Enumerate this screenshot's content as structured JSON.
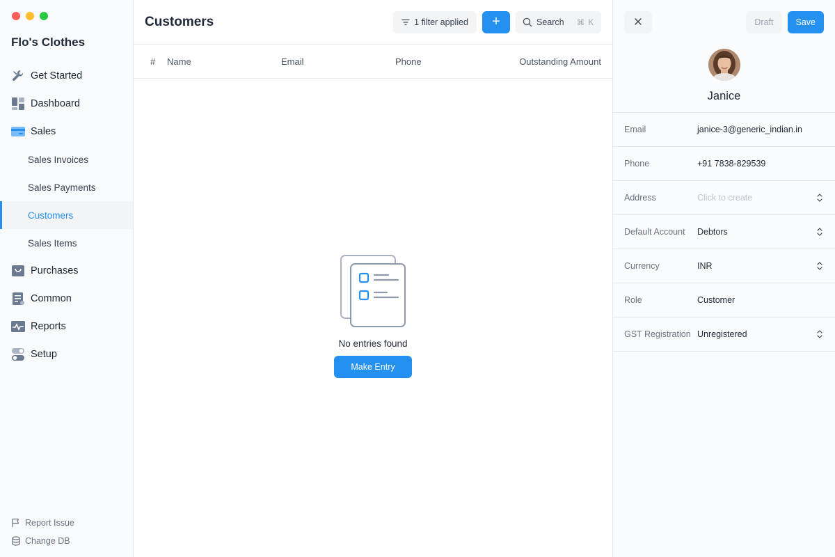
{
  "sidebar": {
    "company": "Flo's Clothes",
    "items": [
      {
        "label": "Get Started",
        "icon": "wrench-icon"
      },
      {
        "label": "Dashboard",
        "icon": "dashboard-icon"
      },
      {
        "label": "Sales",
        "icon": "card-icon"
      },
      {
        "label": "Purchases",
        "icon": "bag-icon"
      },
      {
        "label": "Common",
        "icon": "document-icon"
      },
      {
        "label": "Reports",
        "icon": "chart-icon"
      },
      {
        "label": "Setup",
        "icon": "toggle-icon"
      }
    ],
    "sales_sub": [
      "Sales Invoices",
      "Sales Payments",
      "Customers",
      "Sales Items"
    ],
    "active_sub": "Customers",
    "bottom": [
      {
        "label": "Report Issue",
        "icon": "flag-icon"
      },
      {
        "label": "Change DB",
        "icon": "database-icon"
      }
    ]
  },
  "main": {
    "title": "Customers",
    "filter_label": "1 filter applied",
    "add_label": "+",
    "search_label": "Search",
    "search_shortcut": "⌘ K",
    "columns": [
      "#",
      "Name",
      "Email",
      "Phone",
      "Outstanding Amount"
    ],
    "empty_text": "No entries found",
    "make_entry": "Make Entry"
  },
  "panel": {
    "draft_label": "Draft",
    "save_label": "Save",
    "name": "Janice",
    "fields": [
      {
        "label": "Email",
        "value": "janice-3@generic_indian.in"
      },
      {
        "label": "Phone",
        "value": "+91 7838-829539"
      },
      {
        "label": "Address",
        "value": "Click to create"
      },
      {
        "label": "Default Account",
        "value": "Debtors"
      },
      {
        "label": "Currency",
        "value": "INR"
      },
      {
        "label": "Role",
        "value": "Customer"
      },
      {
        "label": "GST Registration",
        "value": "Unregistered"
      }
    ]
  },
  "colors": {
    "accent": "#2490ef",
    "sidebar_bg": "#f9fafb",
    "border": "#e5e7eb",
    "icon_gray": "#6b7a90"
  }
}
